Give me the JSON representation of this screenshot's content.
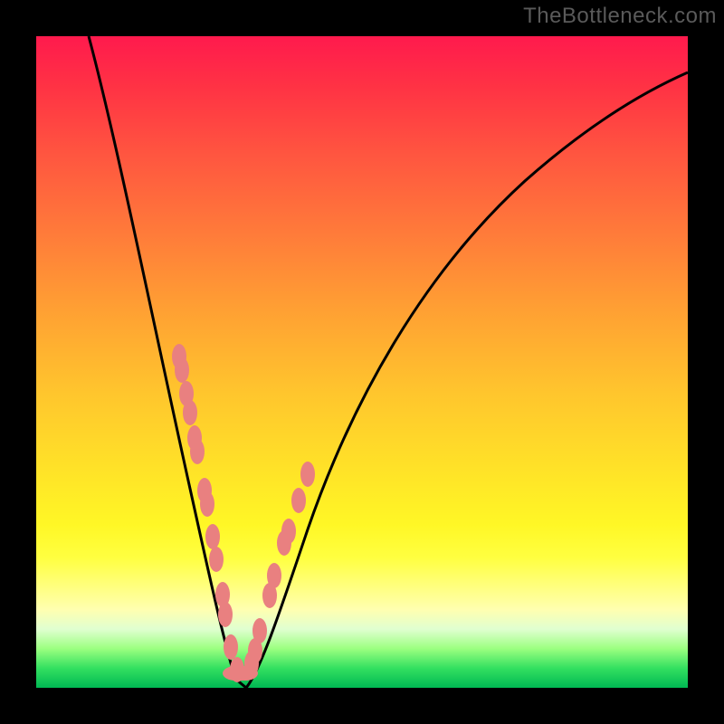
{
  "watermark": "TheBottleneck.com",
  "colors": {
    "curve_stroke": "#000000",
    "marker_fill": "#e98080",
    "frame_bg": "#000000"
  },
  "chart_data": {
    "type": "line",
    "title": "",
    "xlabel": "",
    "ylabel": "",
    "xlim": [
      0,
      100
    ],
    "ylim": [
      0,
      100
    ],
    "grid": false,
    "legend": false,
    "annotations": [
      "TheBottleneck.com"
    ],
    "series": [
      {
        "name": "bottleneck-curve",
        "x": [
          8,
          10,
          12,
          14,
          16,
          18,
          20,
          22,
          24,
          26,
          27,
          28,
          29,
          30,
          31,
          32,
          33,
          34,
          35,
          37,
          40,
          45,
          50,
          55,
          60,
          65,
          70,
          75,
          80,
          85,
          90,
          95,
          100
        ],
        "y": [
          100,
          93,
          86,
          79,
          72,
          65,
          58,
          50,
          42,
          32,
          26,
          20,
          14,
          8,
          4,
          2,
          2,
          4,
          8,
          16,
          26,
          40,
          51,
          60,
          67,
          73,
          78,
          83,
          86,
          89,
          92,
          94,
          96
        ]
      }
    ],
    "markers": {
      "name": "highlight-points",
      "x": [
        22.0,
        22.4,
        23.0,
        23.6,
        24.3,
        24.7,
        25.9,
        26.3,
        27.1,
        27.7,
        28.6,
        29.1,
        29.9,
        30.8,
        30.8,
        30.6,
        31.3,
        32.1,
        33.1,
        33.6,
        34.3,
        35.8,
        36.5,
        38.1,
        38.7,
        40.3,
        41.7
      ],
      "y": [
        50.5,
        48.5,
        45.0,
        42.0,
        38.0,
        36.0,
        30.0,
        28.0,
        23.0,
        19.5,
        14.0,
        11.0,
        6.0,
        2.5,
        2.0,
        2.0,
        2.0,
        2.0,
        3.5,
        5.5,
        8.5,
        14.0,
        17.0,
        22.0,
        24.0,
        28.5,
        32.5
      ]
    }
  }
}
